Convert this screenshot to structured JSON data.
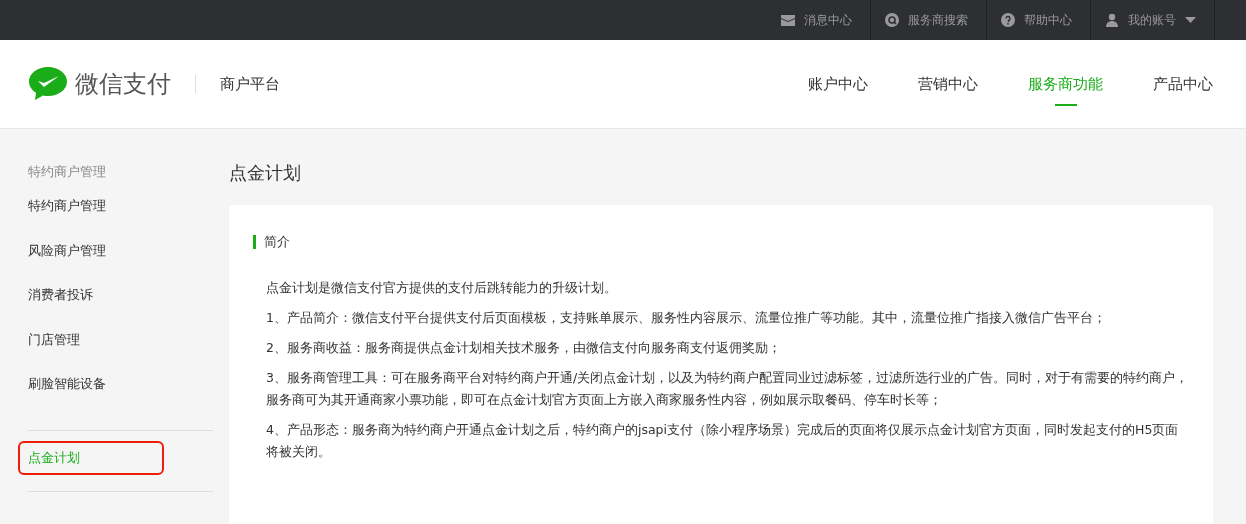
{
  "top_bar": {
    "items": [
      {
        "kind": "mail",
        "label": "消息中心"
      },
      {
        "kind": "search",
        "label": "服务商搜索"
      },
      {
        "kind": "help",
        "label": "帮助中心"
      },
      {
        "kind": "account",
        "label": "我的账号"
      }
    ]
  },
  "header": {
    "logo": "微信支付",
    "platform": "商户平台",
    "nav": [
      {
        "label": "账户中心",
        "selected": false
      },
      {
        "label": "营销中心",
        "selected": false
      },
      {
        "label": "服务商功能",
        "selected": true
      },
      {
        "label": "产品中心",
        "selected": false
      }
    ]
  },
  "sidebar": {
    "groups": [
      {
        "title": "特约商户管理",
        "items": [
          {
            "label": "特约商户管理",
            "selected": false,
            "highlighted": false
          },
          {
            "label": "风险商户管理",
            "selected": false,
            "highlighted": false
          },
          {
            "label": "消费者投诉",
            "selected": false,
            "highlighted": false
          },
          {
            "label": "门店管理",
            "selected": false,
            "highlighted": false
          },
          {
            "label": "刷脸智能设备",
            "selected": false,
            "highlighted": false
          }
        ]
      },
      {
        "items": [
          {
            "label": "点金计划",
            "selected": true,
            "highlighted": true
          }
        ]
      }
    ]
  },
  "page": {
    "title": "点金计划",
    "section": "简介",
    "paragraphs": [
      "点金计划是微信支付官方提供的支付后跳转能力的升级计划。",
      "1、产品简介：微信支付平台提供支付后页面模板，支持账单展示、服务性内容展示、流量位推广等功能。其中，流量位推广指接入微信广告平台；",
      "2、服务商收益：服务商提供点金计划相关技术服务，由微信支付向服务商支付返佣奖励；",
      "3、服务商管理工具：可在服务商平台对特约商户开通/关闭点金计划，以及为特约商户配置同业过滤标签，过滤所选行业的广告。同时，对于有需要的特约商户，服务商可为其开通商家小票功能，即可在点金计划官方页面上方嵌入商家服务性内容，例如展示取餐码、停车时长等；",
      "4、产品形态：服务商为特约商户开通点金计划之后，特约商户的jsapi支付（除小程序场景）完成后的页面将仅展示点金计划官方页面，同时发起支付的H5页面将被关闭。"
    ]
  }
}
